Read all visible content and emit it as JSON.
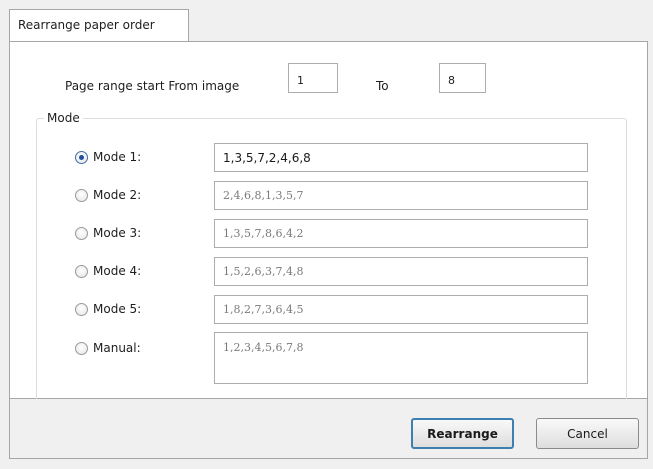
{
  "tab": {
    "title": "Rearrange paper order"
  },
  "range": {
    "label": "Page range start From image",
    "from_value": "1",
    "to_label": "To",
    "to_value": "8"
  },
  "mode_group": {
    "title": "Mode",
    "modes": [
      {
        "label": "Mode 1:",
        "sequence": "1,3,5,7,2,4,6,8",
        "selected": true
      },
      {
        "label": "Mode 2:",
        "sequence": "2,4,6,8,1,3,5,7",
        "selected": false
      },
      {
        "label": "Mode 3:",
        "sequence": "1,3,5,7,8,6,4,2",
        "selected": false
      },
      {
        "label": "Mode 4:",
        "sequence": "1,5,2,6,3,7,4,8",
        "selected": false
      },
      {
        "label": "Mode 5:",
        "sequence": "1,8,2,7,3,6,4,5",
        "selected": false
      }
    ],
    "manual": {
      "label": "Manual:",
      "sequence": "1,2,3,4,5,6,7,8",
      "selected": false
    }
  },
  "buttons": {
    "rearrange": "Rearrange",
    "cancel": "Cancel"
  }
}
